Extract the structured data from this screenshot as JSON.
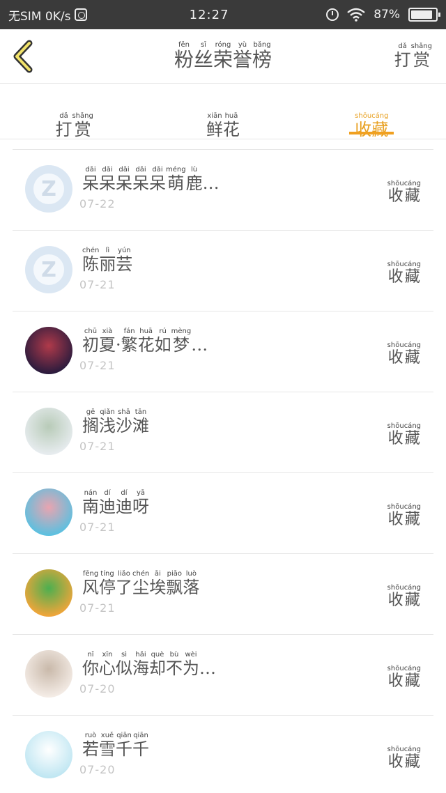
{
  "status_bar": {
    "carrier": "无SIM 0K/s",
    "time": "12:27",
    "battery": "87%"
  },
  "header": {
    "title": [
      {
        "py": "fěn",
        "hz": "粉"
      },
      {
        "py": "sī",
        "hz": "丝"
      },
      {
        "py": "róng",
        "hz": "荣"
      },
      {
        "py": "yù",
        "hz": "誉"
      },
      {
        "py": "bǎng",
        "hz": "榜"
      }
    ],
    "action": [
      {
        "py": "dǎ",
        "hz": "打"
      },
      {
        "py": "shǎng",
        "hz": "赏"
      }
    ]
  },
  "tabs": [
    {
      "chars": [
        {
          "py": "dǎ",
          "hz": "打"
        },
        {
          "py": "shǎng",
          "hz": "赏"
        }
      ],
      "active": false
    },
    {
      "chars": [
        {
          "py": "xiān",
          "hz": "鲜"
        },
        {
          "py": "huā",
          "hz": "花"
        }
      ],
      "active": false
    },
    {
      "chars": [
        {
          "py": "shōu",
          "hz": "收"
        },
        {
          "py": "cáng",
          "hz": "藏"
        }
      ],
      "active": true
    }
  ],
  "collect_label": [
    {
      "py": "shōu",
      "hz": "收"
    },
    {
      "py": "cáng",
      "hz": "藏"
    }
  ],
  "list": [
    {
      "name": [
        {
          "py": "dāi",
          "hz": "呆"
        },
        {
          "py": "dāi",
          "hz": "呆"
        },
        {
          "py": "dāi",
          "hz": "呆"
        },
        {
          "py": "dāi",
          "hz": "呆"
        },
        {
          "py": "dāi",
          "hz": "呆"
        },
        {
          "py": "méng",
          "hz": "萌"
        },
        {
          "py": "lù",
          "hz": "鹿"
        },
        {
          "py": "",
          "hz": "…"
        }
      ],
      "date": "07-22",
      "avatar": "default-avatar",
      "avatar_colors": [
        "#dbe7f3",
        "#dbe7f3"
      ]
    },
    {
      "name": [
        {
          "py": "chén",
          "hz": "陈"
        },
        {
          "py": "lì",
          "hz": "丽"
        },
        {
          "py": "yún",
          "hz": "芸"
        }
      ],
      "date": "07-21",
      "avatar": "default-avatar",
      "avatar_colors": [
        "#dbe7f3",
        "#dbe7f3"
      ]
    },
    {
      "name": [
        {
          "py": "chū",
          "hz": "初"
        },
        {
          "py": "xià",
          "hz": "夏"
        },
        {
          "py": "",
          "hz": "·"
        },
        {
          "py": "fán",
          "hz": "繁"
        },
        {
          "py": "huā",
          "hz": "花"
        },
        {
          "py": "rú",
          "hz": "如"
        },
        {
          "py": "mèng",
          "hz": "梦"
        },
        {
          "py": "",
          "hz": "…"
        }
      ],
      "date": "07-21",
      "avatar": "photo-avatar",
      "avatar_colors": [
        "#2a1b3d",
        "#b03a4a"
      ]
    },
    {
      "name": [
        {
          "py": "gē",
          "hz": "搁"
        },
        {
          "py": "qiǎn",
          "hz": "浅"
        },
        {
          "py": "shā",
          "hz": "沙"
        },
        {
          "py": "tān",
          "hz": "滩"
        }
      ],
      "date": "07-21",
      "avatar": "photo-avatar",
      "avatar_colors": [
        "#e7ecef",
        "#b8cbb8"
      ]
    },
    {
      "name": [
        {
          "py": "nán",
          "hz": "南"
        },
        {
          "py": "dí",
          "hz": "迪"
        },
        {
          "py": "dí",
          "hz": "迪"
        },
        {
          "py": "yā",
          "hz": "呀"
        }
      ],
      "date": "07-21",
      "avatar": "photo-avatar",
      "avatar_colors": [
        "#5bc0e0",
        "#e9a4b0"
      ]
    },
    {
      "name": [
        {
          "py": "fēng",
          "hz": "风"
        },
        {
          "py": "tíng",
          "hz": "停"
        },
        {
          "py": "liǎo",
          "hz": "了"
        },
        {
          "py": "chén",
          "hz": "尘"
        },
        {
          "py": "āi",
          "hz": "埃"
        },
        {
          "py": "piāo",
          "hz": "飘"
        },
        {
          "py": "luò",
          "hz": "落"
        }
      ],
      "date": "07-21",
      "avatar": "photo-avatar",
      "avatar_colors": [
        "#f0a53a",
        "#4caf50"
      ]
    },
    {
      "name": [
        {
          "py": "nǐ",
          "hz": "你"
        },
        {
          "py": "xīn",
          "hz": "心"
        },
        {
          "py": "sì",
          "hz": "似"
        },
        {
          "py": "hǎi",
          "hz": "海"
        },
        {
          "py": "què",
          "hz": "却"
        },
        {
          "py": "bù",
          "hz": "不"
        },
        {
          "py": "wèi",
          "hz": "为"
        },
        {
          "py": "",
          "hz": "…"
        }
      ],
      "date": "07-20",
      "avatar": "photo-avatar",
      "avatar_colors": [
        "#f4ece6",
        "#c9b9aa"
      ]
    },
    {
      "name": [
        {
          "py": "ruò",
          "hz": "若"
        },
        {
          "py": "xuě",
          "hz": "雪"
        },
        {
          "py": "qiān",
          "hz": "千"
        },
        {
          "py": "qiān",
          "hz": "千"
        }
      ],
      "date": "07-20",
      "avatar": "photo-avatar",
      "avatar_colors": [
        "#bfe6f2",
        "#ffffff"
      ]
    }
  ]
}
